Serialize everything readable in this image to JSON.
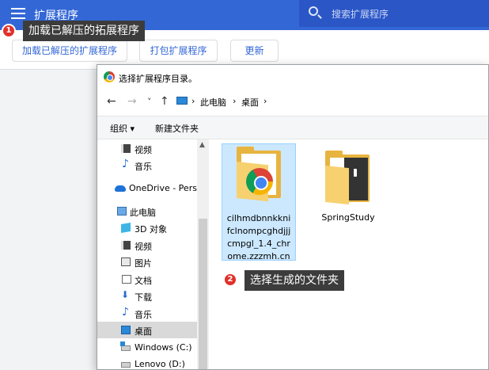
{
  "header": {
    "title": "扩展程序",
    "search_placeholder": "搜索扩展程序"
  },
  "devbar": {
    "load_unpacked": "加载已解压的扩展程序",
    "pack": "打包扩展程序",
    "update": "更新"
  },
  "callouts": [
    {
      "number": "1",
      "text": "加载已解压的拓展程序"
    },
    {
      "number": "2",
      "text": "选择生成的文件夹"
    }
  ],
  "dialog": {
    "title": "选择扩展程序目录。",
    "nav": {
      "back": "←",
      "forward": "→",
      "recent": "˅",
      "up": "↑"
    },
    "breadcrumb": [
      "此电脑",
      "桌面"
    ],
    "organize": "组织 ▾",
    "new_folder": "新建文件夹",
    "sidebar": [
      {
        "label": "视频",
        "icon": "video-icon"
      },
      {
        "label": "音乐",
        "icon": "music-icon"
      },
      {
        "label": "OneDrive - Perso",
        "icon": "onedrive-icon"
      },
      {
        "label": "此电脑",
        "icon": "computer-icon"
      },
      {
        "label": "3D 对象",
        "icon": "3d-objects-icon"
      },
      {
        "label": "视频",
        "icon": "video-icon"
      },
      {
        "label": "图片",
        "icon": "pictures-icon"
      },
      {
        "label": "文档",
        "icon": "documents-icon"
      },
      {
        "label": "下载",
        "icon": "download-icon"
      },
      {
        "label": "音乐",
        "icon": "music-icon"
      },
      {
        "label": "桌面",
        "icon": "desktop-icon",
        "selected": true
      },
      {
        "label": "Windows (C:)",
        "icon": "windows-drive-icon"
      },
      {
        "label": "Lenovo (D:)",
        "icon": "drive-icon"
      }
    ],
    "files": [
      {
        "name": "cilhmdbnnkknifclnompcghdjjjcmpgl_1.4_chrome.zzzmh.cn",
        "selected": true
      },
      {
        "name": "SpringStudy",
        "selected": false
      }
    ]
  }
}
